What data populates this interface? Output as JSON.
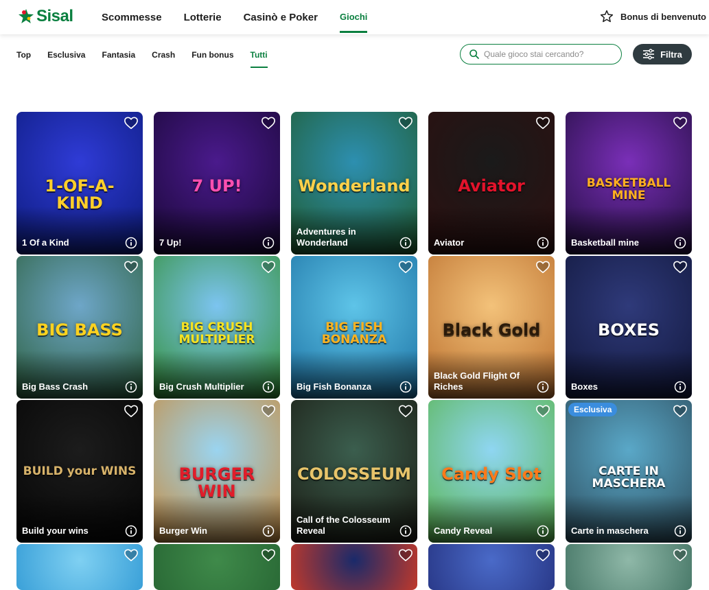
{
  "header": {
    "logo_text": "Sisal",
    "nav": [
      {
        "label": "Scommesse"
      },
      {
        "label": "Lotterie"
      },
      {
        "label": "Casinò e Poker"
      },
      {
        "label": "Giochi"
      }
    ],
    "active_nav": "Giochi",
    "bonus_label": "Bonus di benvenuto"
  },
  "subnav": {
    "items": [
      {
        "label": "Top"
      },
      {
        "label": "Esclusiva"
      },
      {
        "label": "Fantasia"
      },
      {
        "label": "Crash"
      },
      {
        "label": "Fun bonus"
      },
      {
        "label": "Tutti"
      }
    ],
    "active": "Tutti"
  },
  "search": {
    "placeholder": "Quale gioco stai cercando?"
  },
  "filter_button": {
    "label": "Filtra"
  },
  "games": [
    {
      "title": "1 Of a Kind",
      "logo": "1-OF-A-KIND",
      "bg": "#2f3bd6",
      "bg2": "#0b1a7a",
      "logo_color": "#ffcf2a",
      "badge": ""
    },
    {
      "title": "7 Up!",
      "logo": "7 UP!",
      "bg": "#4a1a8c",
      "bg2": "#170733",
      "logo_color": "#ff4fb0",
      "badge": ""
    },
    {
      "title": "Adventures in Wonderland",
      "logo": "Wonderland",
      "bg": "#2d8fb0",
      "bg2": "#1f5a2b",
      "logo_color": "#ffd14a",
      "badge": ""
    },
    {
      "title": "Aviator",
      "logo": "Aviator",
      "bg": "#1a1a1a",
      "bg2": "#2e0f0f",
      "logo_color": "#e3132b",
      "badge": ""
    },
    {
      "title": "Basketball mine",
      "logo": "BASKETBALL MINE",
      "bg": "#7a2fb8",
      "bg2": "#1e0c3a",
      "logo_color": "#ffb020",
      "badge": ""
    },
    {
      "title": "Big Bass Crash",
      "logo": "BIG BASS",
      "bg": "#6ea6c8",
      "bg2": "#2a5e3a",
      "logo_color": "#ffd21f",
      "badge": ""
    },
    {
      "title": "Big Crush Multiplier",
      "logo": "BIG CRUSH MULTIPLIER",
      "bg": "#7cc4f0",
      "bg2": "#2f8d2f",
      "logo_color": "#f7e321",
      "badge": ""
    },
    {
      "title": "Big Fish Bonanza",
      "logo": "BIG FISH BONANZA",
      "bg": "#5ec4e8",
      "bg2": "#1a6fa1",
      "logo_color": "#ffb31f",
      "badge": ""
    },
    {
      "title": "Black Gold Flight Of Riches",
      "logo": "Black Gold",
      "bg": "#f3c27a",
      "bg2": "#b86b2a",
      "logo_color": "#2a1a0a",
      "badge": ""
    },
    {
      "title": "Boxes",
      "logo": "BOXES",
      "bg": "#2f3a7a",
      "bg2": "#10163a",
      "logo_color": "#ffffff",
      "badge": ""
    },
    {
      "title": "Build your wins",
      "logo": "BUILD your WINS",
      "bg": "#1c1c1c",
      "bg2": "#050505",
      "logo_color": "#d8b36a",
      "badge": ""
    },
    {
      "title": "Burger Win",
      "logo": "BURGER WIN",
      "bg": "#9ad4f0",
      "bg2": "#c98a3a",
      "logo_color": "#e11d2a",
      "badge": ""
    },
    {
      "title": "Call of the Colosseum Reveal",
      "logo": "COLOSSEUM",
      "bg": "#3b5e4e",
      "bg2": "#1a1a12",
      "logo_color": "#e8c46a",
      "badge": ""
    },
    {
      "title": "Candy Reveal",
      "logo": "Candy Slot",
      "bg": "#8fd6f2",
      "bg2": "#57b347",
      "logo_color": "#ff7a1a",
      "badge": ""
    },
    {
      "title": "Carte in maschera",
      "logo": "CARTE IN MASCHERA",
      "bg": "#5aa8c8",
      "bg2": "#2b4a5a",
      "logo_color": "#ffffff",
      "badge": "Esclusiva"
    },
    {
      "title": "",
      "logo": "",
      "bg": "#7fd0f2",
      "bg2": "#3aa0d8",
      "logo_color": "#fff",
      "badge": ""
    },
    {
      "title": "",
      "logo": "",
      "bg": "#3f8a4a",
      "bg2": "#2a6a36",
      "logo_color": "#fff",
      "badge": ""
    },
    {
      "title": "",
      "logo": "",
      "bg": "#1a2a6a",
      "bg2": "#c0392b",
      "logo_color": "#fff",
      "badge": ""
    },
    {
      "title": "",
      "logo": "",
      "bg": "#4a6ac8",
      "bg2": "#2a3a8a",
      "logo_color": "#fff",
      "badge": ""
    },
    {
      "title": "",
      "logo": "",
      "bg": "#8fb8a8",
      "bg2": "#4a7a6a",
      "logo_color": "#fff",
      "badge": ""
    }
  ]
}
